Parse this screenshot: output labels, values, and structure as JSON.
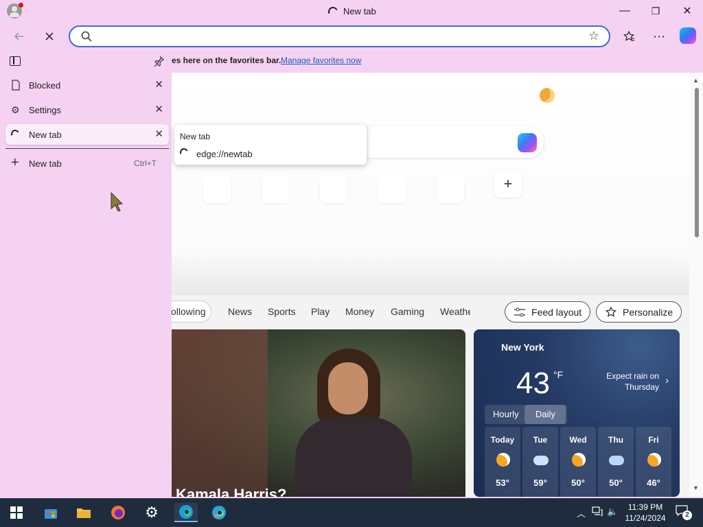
{
  "window": {
    "title": "New tab",
    "minimize_glyph": "—",
    "maximize_glyph": "❐",
    "close_glyph": "✕"
  },
  "toolbar": {
    "address_value": "",
    "address_placeholder": "",
    "icons": [
      "back-icon",
      "stop-icon",
      "search-icon",
      "favorite-star-icon",
      "favorites-icon",
      "more-icon",
      "copilot-icon"
    ]
  },
  "favorites_bar": {
    "text": "es here on the favorites bar.",
    "link": "Manage favorites now"
  },
  "tabs_panel": {
    "tabs": [
      {
        "label": "Blocked",
        "icon": "page-icon",
        "close": "✕"
      },
      {
        "label": "Settings",
        "icon": "gear-icon",
        "close": "✕"
      },
      {
        "label": "New tab",
        "icon": "loading-icon",
        "close": "✕"
      }
    ],
    "new_tab": {
      "label": "New tab",
      "shortcut": "Ctrl+T"
    }
  },
  "tooltip": {
    "title": "New tab",
    "url": "edge://newtab"
  },
  "feed": {
    "following": "ollowing",
    "nav": [
      "News",
      "Sports",
      "Play",
      "Money",
      "Gaming",
      "Weathe"
    ],
    "feed_layout": "Feed layout",
    "personalize": "Personalize",
    "headline": "Kamala Harris?"
  },
  "weather": {
    "city": "New York",
    "temp": "43",
    "unit": "°F",
    "forecast_line1": "Expect rain on",
    "forecast_line2": "Thursday",
    "toggle_hourly": "Hourly",
    "toggle_daily": "Daily",
    "days": [
      {
        "name": "Today",
        "temp": "53°",
        "icon": "partly-sunny-icon"
      },
      {
        "name": "Tue",
        "temp": "59°",
        "icon": "cloudy-icon"
      },
      {
        "name": "Wed",
        "temp": "50°",
        "icon": "partly-sunny-icon"
      },
      {
        "name": "Thu",
        "temp": "50°",
        "icon": "rain-icon"
      },
      {
        "name": "Fri",
        "temp": "46°",
        "icon": "partly-sunny-icon"
      }
    ]
  },
  "taskbar": {
    "time": "11:39 PM",
    "date": "11/24/2024",
    "notifications": "2"
  },
  "colors": {
    "chrome_bg": "#f5d2f2",
    "address_border": "#3c6ad6",
    "link": "#1d5bb8",
    "taskbar_bg": "#1f2c3d"
  }
}
